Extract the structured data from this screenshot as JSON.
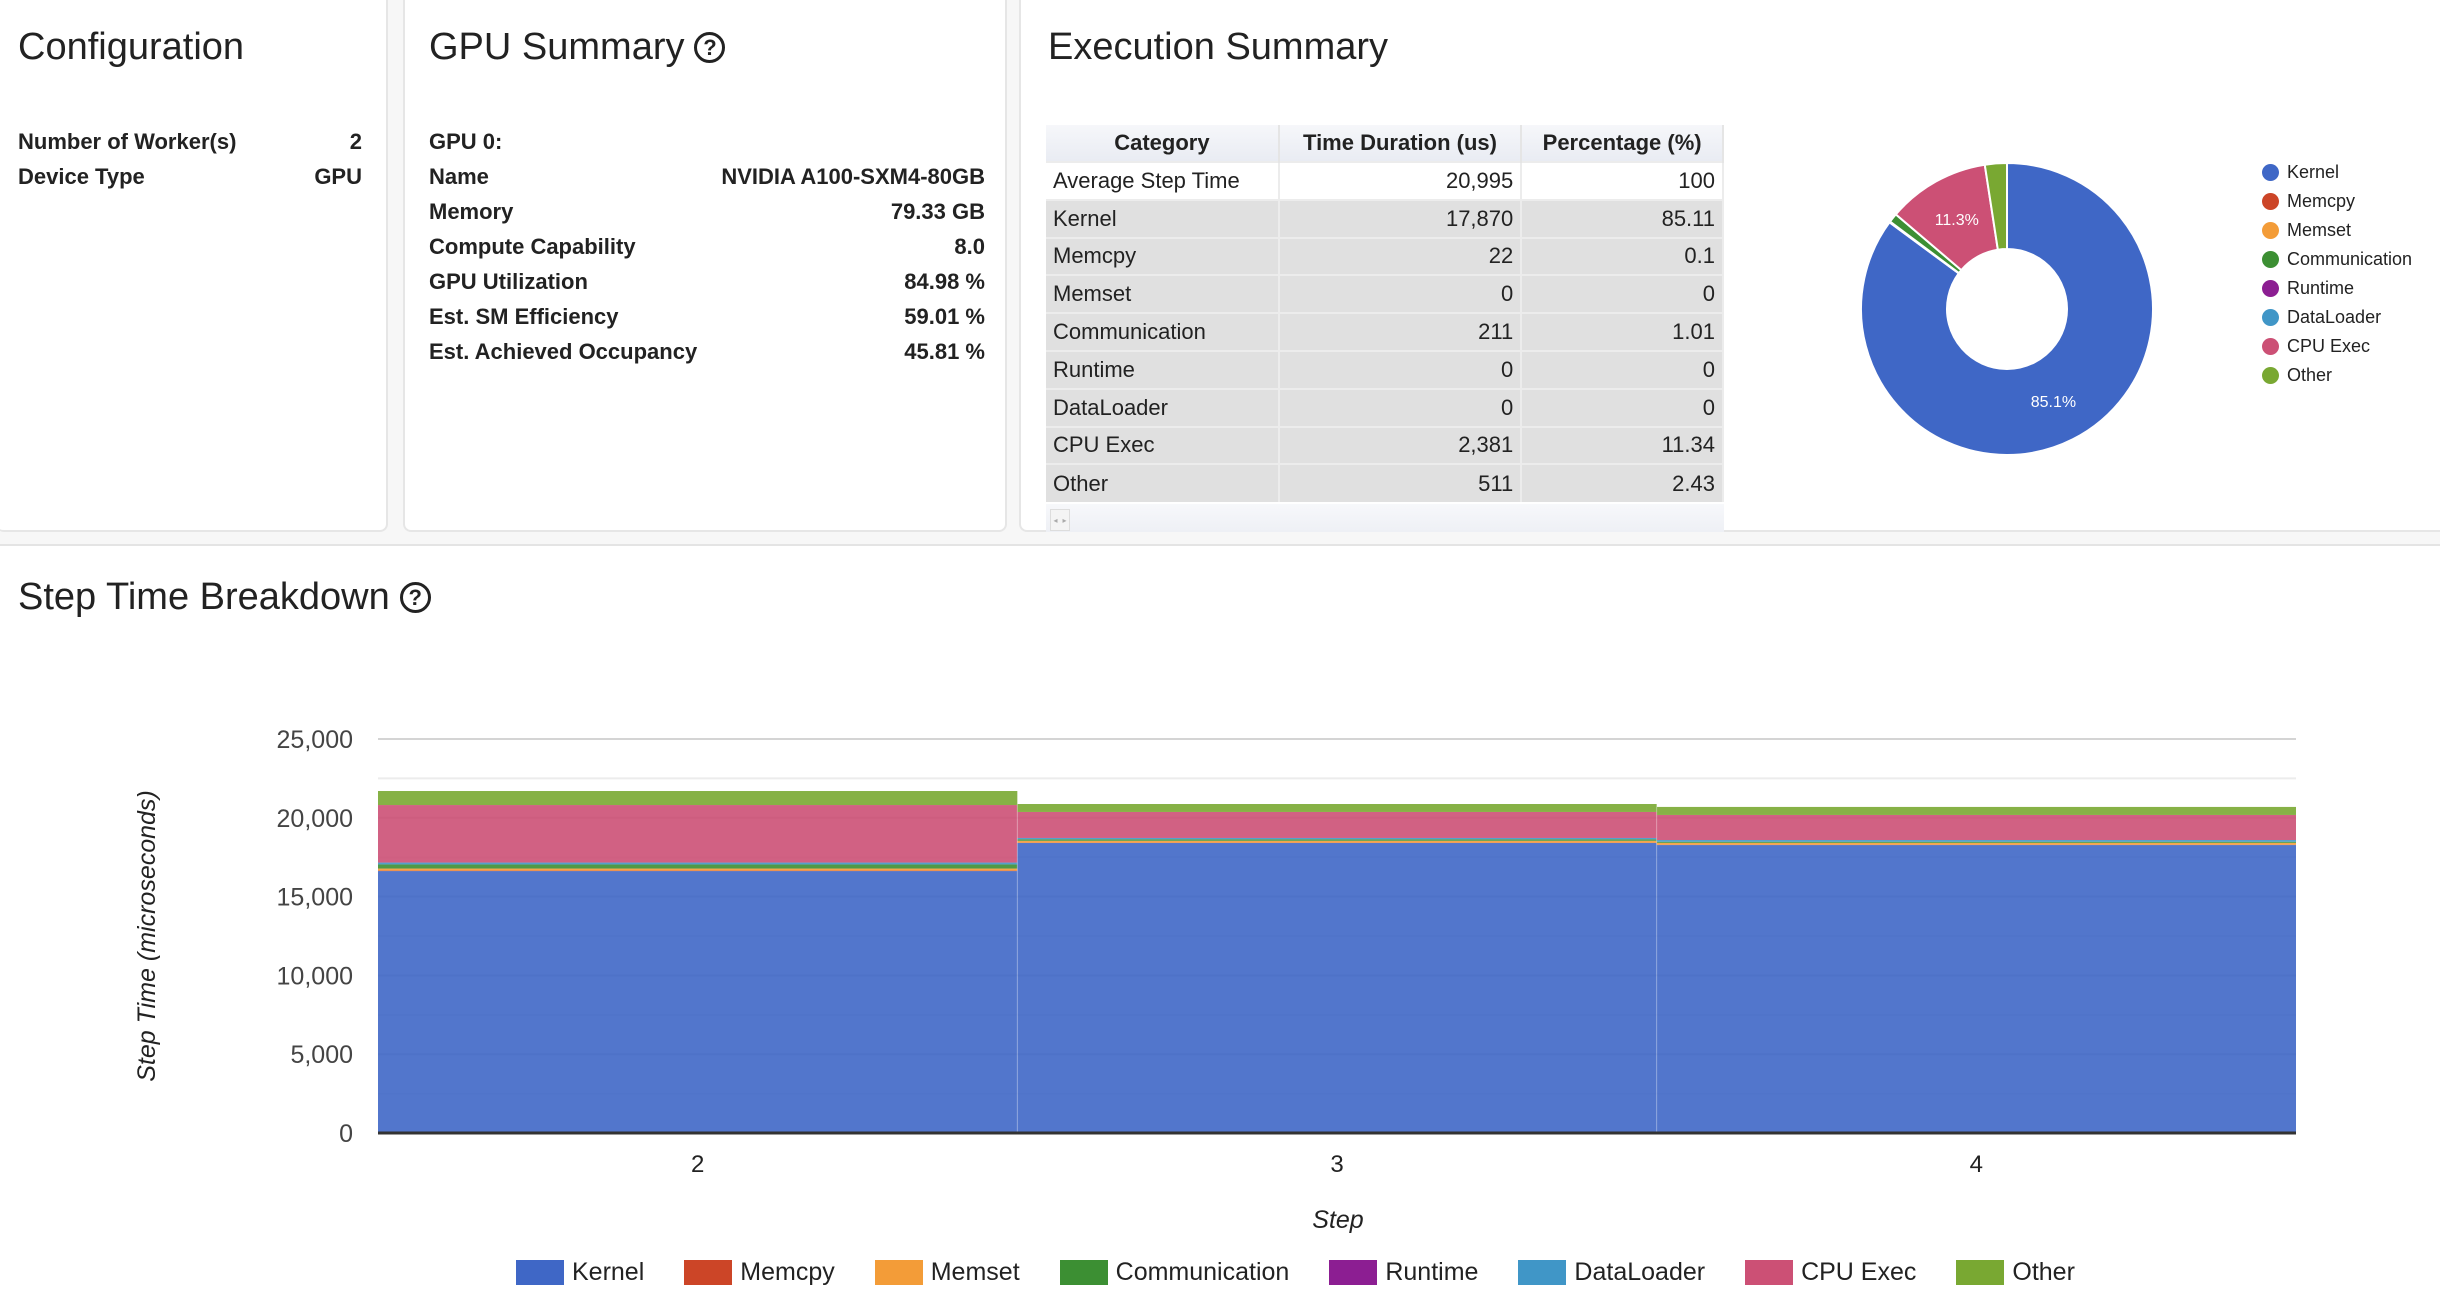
{
  "configuration": {
    "title": "Configuration",
    "rows": [
      {
        "label": "Number of Worker(s)",
        "value": "2"
      },
      {
        "label": "Device Type",
        "value": "GPU"
      }
    ]
  },
  "gpu_summary": {
    "title": "GPU Summary",
    "help_icon": "help-circle-icon",
    "gpu_heading": "GPU 0:",
    "rows": [
      {
        "label": "Name",
        "value": "NVIDIA A100-SXM4-80GB"
      },
      {
        "label": "Memory",
        "value": "79.33 GB"
      },
      {
        "label": "Compute Capability",
        "value": "8.0"
      },
      {
        "label": "GPU Utilization",
        "value": "84.98 %"
      },
      {
        "label": "Est. SM Efficiency",
        "value": "59.01 %"
      },
      {
        "label": "Est. Achieved Occupancy",
        "value": "45.81 %"
      }
    ]
  },
  "execution_summary": {
    "title": "Execution Summary",
    "table": {
      "headers": [
        "Category",
        "Time Duration (us)",
        "Percentage (%)"
      ],
      "rows": [
        [
          "Average Step Time",
          "20,995",
          "100"
        ],
        [
          "Kernel",
          "17,870",
          "85.11"
        ],
        [
          "Memcpy",
          "22",
          "0.1"
        ],
        [
          "Memset",
          "0",
          "0"
        ],
        [
          "Communication",
          "211",
          "1.01"
        ],
        [
          "Runtime",
          "0",
          "0"
        ],
        [
          "DataLoader",
          "0",
          "0"
        ],
        [
          "CPU Exec",
          "2,381",
          "11.34"
        ],
        [
          "Other",
          "511",
          "2.43"
        ]
      ]
    },
    "scroll_arrows": [
      "◂",
      "▸"
    ]
  },
  "colors": {
    "Kernel": "#3f67c6",
    "Memcpy": "#cc4527",
    "Memset": "#f39c38",
    "Communication": "#3c8f33",
    "Runtime": "#8c1e92",
    "DataLoader": "#4096c7",
    "CPU Exec": "#cc5075",
    "Other": "#79a832"
  },
  "chart_data": [
    {
      "type": "pie",
      "title": "Execution Summary",
      "donut": true,
      "labels": [
        "Kernel",
        "Memcpy",
        "Memset",
        "Communication",
        "Runtime",
        "DataLoader",
        "CPU Exec",
        "Other"
      ],
      "values": [
        17870,
        22,
        0,
        211,
        0,
        0,
        2381,
        511
      ],
      "slice_labels_shown": {
        "Kernel": "85.1%",
        "CPU Exec": "11.3%"
      },
      "legend": "right"
    },
    {
      "type": "area",
      "stacked": true,
      "title": "Step Time Breakdown",
      "xlabel": "Step",
      "ylabel": "Step Time (microseconds)",
      "categories": [
        "2",
        "3",
        "4"
      ],
      "ylim": [
        0,
        25000
      ],
      "yticks": [
        0,
        5000,
        10000,
        15000,
        20000,
        25000
      ],
      "ytick_labels": [
        "0",
        "5,000",
        "10,000",
        "15,000",
        "20,000",
        "25,000"
      ],
      "series": [
        {
          "name": "Kernel",
          "values": [
            16620,
            18400,
            18270
          ]
        },
        {
          "name": "Memcpy",
          "values": [
            30,
            20,
            20
          ]
        },
        {
          "name": "Memset",
          "values": [
            130,
            120,
            120
          ]
        },
        {
          "name": "Communication",
          "values": [
            260,
            100,
            70
          ]
        },
        {
          "name": "Runtime",
          "values": [
            0,
            0,
            0
          ]
        },
        {
          "name": "DataLoader",
          "values": [
            120,
            80,
            110
          ]
        },
        {
          "name": "CPU Exec",
          "values": [
            3650,
            1650,
            1590
          ]
        },
        {
          "name": "Other",
          "values": [
            890,
            505,
            510
          ]
        }
      ],
      "legend": "bottom",
      "grid": true
    }
  ],
  "step_breakdown": {
    "title": "Step Time Breakdown",
    "help_icon": "help-circle-icon"
  }
}
